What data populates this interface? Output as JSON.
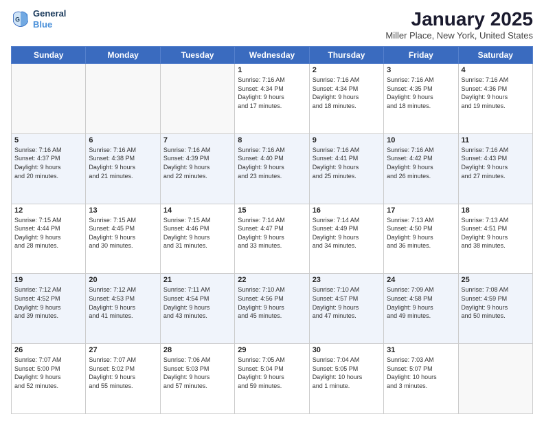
{
  "header": {
    "logo": {
      "line1": "General",
      "line2": "Blue"
    },
    "title": "January 2025",
    "subtitle": "Miller Place, New York, United States"
  },
  "days_of_week": [
    "Sunday",
    "Monday",
    "Tuesday",
    "Wednesday",
    "Thursday",
    "Friday",
    "Saturday"
  ],
  "weeks": [
    [
      {
        "day": "",
        "info": ""
      },
      {
        "day": "",
        "info": ""
      },
      {
        "day": "",
        "info": ""
      },
      {
        "day": "1",
        "info": "Sunrise: 7:16 AM\nSunset: 4:34 PM\nDaylight: 9 hours\nand 17 minutes."
      },
      {
        "day": "2",
        "info": "Sunrise: 7:16 AM\nSunset: 4:34 PM\nDaylight: 9 hours\nand 18 minutes."
      },
      {
        "day": "3",
        "info": "Sunrise: 7:16 AM\nSunset: 4:35 PM\nDaylight: 9 hours\nand 18 minutes."
      },
      {
        "day": "4",
        "info": "Sunrise: 7:16 AM\nSunset: 4:36 PM\nDaylight: 9 hours\nand 19 minutes."
      }
    ],
    [
      {
        "day": "5",
        "info": "Sunrise: 7:16 AM\nSunset: 4:37 PM\nDaylight: 9 hours\nand 20 minutes."
      },
      {
        "day": "6",
        "info": "Sunrise: 7:16 AM\nSunset: 4:38 PM\nDaylight: 9 hours\nand 21 minutes."
      },
      {
        "day": "7",
        "info": "Sunrise: 7:16 AM\nSunset: 4:39 PM\nDaylight: 9 hours\nand 22 minutes."
      },
      {
        "day": "8",
        "info": "Sunrise: 7:16 AM\nSunset: 4:40 PM\nDaylight: 9 hours\nand 23 minutes."
      },
      {
        "day": "9",
        "info": "Sunrise: 7:16 AM\nSunset: 4:41 PM\nDaylight: 9 hours\nand 25 minutes."
      },
      {
        "day": "10",
        "info": "Sunrise: 7:16 AM\nSunset: 4:42 PM\nDaylight: 9 hours\nand 26 minutes."
      },
      {
        "day": "11",
        "info": "Sunrise: 7:16 AM\nSunset: 4:43 PM\nDaylight: 9 hours\nand 27 minutes."
      }
    ],
    [
      {
        "day": "12",
        "info": "Sunrise: 7:15 AM\nSunset: 4:44 PM\nDaylight: 9 hours\nand 28 minutes."
      },
      {
        "day": "13",
        "info": "Sunrise: 7:15 AM\nSunset: 4:45 PM\nDaylight: 9 hours\nand 30 minutes."
      },
      {
        "day": "14",
        "info": "Sunrise: 7:15 AM\nSunset: 4:46 PM\nDaylight: 9 hours\nand 31 minutes."
      },
      {
        "day": "15",
        "info": "Sunrise: 7:14 AM\nSunset: 4:47 PM\nDaylight: 9 hours\nand 33 minutes."
      },
      {
        "day": "16",
        "info": "Sunrise: 7:14 AM\nSunset: 4:49 PM\nDaylight: 9 hours\nand 34 minutes."
      },
      {
        "day": "17",
        "info": "Sunrise: 7:13 AM\nSunset: 4:50 PM\nDaylight: 9 hours\nand 36 minutes."
      },
      {
        "day": "18",
        "info": "Sunrise: 7:13 AM\nSunset: 4:51 PM\nDaylight: 9 hours\nand 38 minutes."
      }
    ],
    [
      {
        "day": "19",
        "info": "Sunrise: 7:12 AM\nSunset: 4:52 PM\nDaylight: 9 hours\nand 39 minutes."
      },
      {
        "day": "20",
        "info": "Sunrise: 7:12 AM\nSunset: 4:53 PM\nDaylight: 9 hours\nand 41 minutes."
      },
      {
        "day": "21",
        "info": "Sunrise: 7:11 AM\nSunset: 4:54 PM\nDaylight: 9 hours\nand 43 minutes."
      },
      {
        "day": "22",
        "info": "Sunrise: 7:10 AM\nSunset: 4:56 PM\nDaylight: 9 hours\nand 45 minutes."
      },
      {
        "day": "23",
        "info": "Sunrise: 7:10 AM\nSunset: 4:57 PM\nDaylight: 9 hours\nand 47 minutes."
      },
      {
        "day": "24",
        "info": "Sunrise: 7:09 AM\nSunset: 4:58 PM\nDaylight: 9 hours\nand 49 minutes."
      },
      {
        "day": "25",
        "info": "Sunrise: 7:08 AM\nSunset: 4:59 PM\nDaylight: 9 hours\nand 50 minutes."
      }
    ],
    [
      {
        "day": "26",
        "info": "Sunrise: 7:07 AM\nSunset: 5:00 PM\nDaylight: 9 hours\nand 52 minutes."
      },
      {
        "day": "27",
        "info": "Sunrise: 7:07 AM\nSunset: 5:02 PM\nDaylight: 9 hours\nand 55 minutes."
      },
      {
        "day": "28",
        "info": "Sunrise: 7:06 AM\nSunset: 5:03 PM\nDaylight: 9 hours\nand 57 minutes."
      },
      {
        "day": "29",
        "info": "Sunrise: 7:05 AM\nSunset: 5:04 PM\nDaylight: 9 hours\nand 59 minutes."
      },
      {
        "day": "30",
        "info": "Sunrise: 7:04 AM\nSunset: 5:05 PM\nDaylight: 10 hours\nand 1 minute."
      },
      {
        "day": "31",
        "info": "Sunrise: 7:03 AM\nSunset: 5:07 PM\nDaylight: 10 hours\nand 3 minutes."
      },
      {
        "day": "",
        "info": ""
      }
    ]
  ]
}
